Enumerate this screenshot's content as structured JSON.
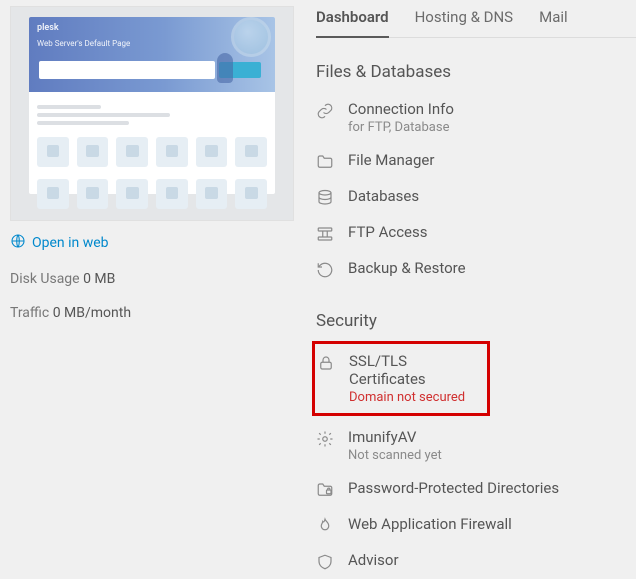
{
  "thumb": {
    "brand": "plesk",
    "headline": "Web Server's Default Page"
  },
  "open_in_web": "Open in web",
  "disk_usage_label": "Disk Usage",
  "disk_usage_value": "0 MB",
  "traffic_label": "Traffic",
  "traffic_value": "0 MB/month",
  "tabs": {
    "dashboard": "Dashboard",
    "hosting": "Hosting & DNS",
    "mail": "Mail"
  },
  "sections": {
    "files": "Files & Databases",
    "security": "Security"
  },
  "files_items": {
    "connection": {
      "label": "Connection Info",
      "sub": "for FTP, Database"
    },
    "file_manager": {
      "label": "File Manager"
    },
    "databases": {
      "label": "Databases"
    },
    "ftp": {
      "label": "FTP Access"
    },
    "backup": {
      "label": "Backup & Restore"
    }
  },
  "security_items": {
    "ssl": {
      "label": "SSL/TLS Certificates",
      "sub": "Domain not secured"
    },
    "imunify": {
      "label": "ImunifyAV",
      "sub": "Not scanned yet"
    },
    "pwd": {
      "label": "Password-Protected Directories"
    },
    "waf": {
      "label": "Web Application Firewall"
    },
    "advisor": {
      "label": "Advisor"
    }
  }
}
